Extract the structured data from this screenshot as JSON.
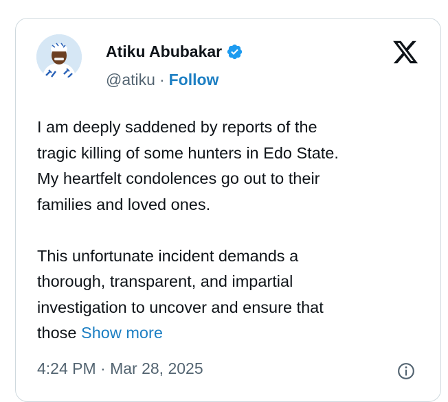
{
  "author": {
    "name": "Atiku Abubakar",
    "handle": "@atiku",
    "separator": "·",
    "follow_label": "Follow",
    "verified_color": "#1d9bf0"
  },
  "icons": {
    "brand": "x-logo-icon",
    "badge": "verified-badge-icon",
    "info": "info-icon"
  },
  "tweet": {
    "lines": [
      "I am deeply saddened by reports of the",
      "tragic killing of some hunters in Edo State.",
      "My heartfelt condolences go out to their",
      "families and loved ones.",
      "This unfortunate incident demands a",
      "thorough, transparent, and impartial",
      "investigation to uncover and ensure that",
      "those"
    ],
    "show_more_label": "Show more",
    "timestamp": "4:24 PM · Mar 28, 2025"
  },
  "colors": {
    "link": "#1d7fc3",
    "muted": "#536471",
    "text": "#0f1419",
    "border": "#cfd9de"
  }
}
